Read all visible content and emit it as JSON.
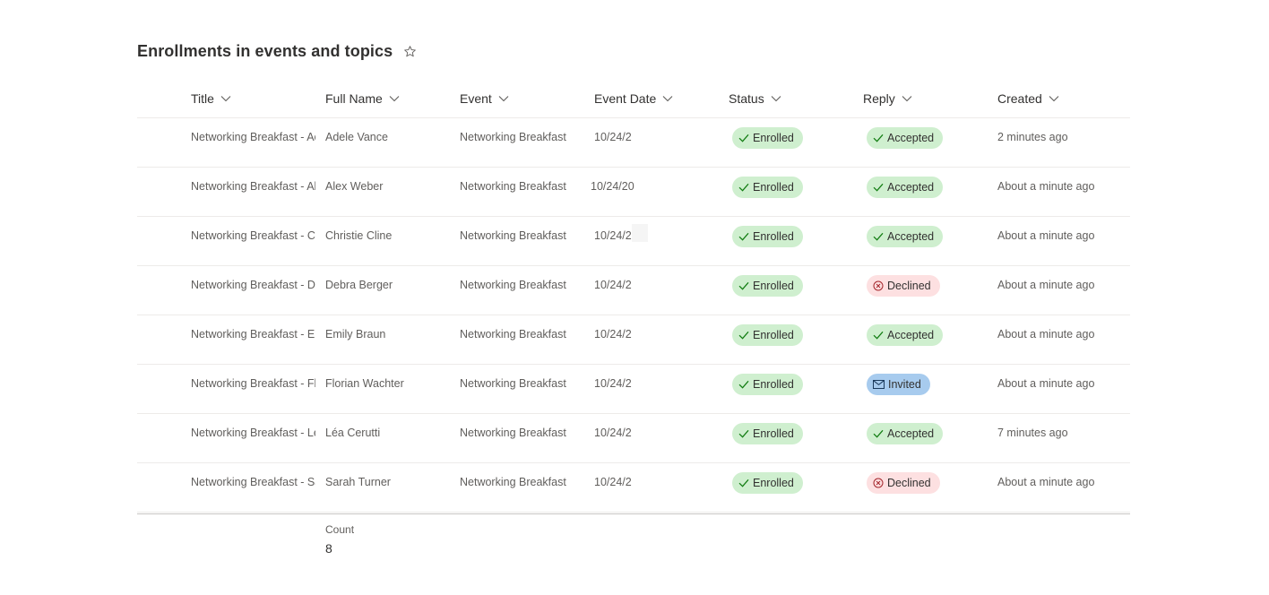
{
  "page": {
    "title": "Enrollments in events and topics",
    "favorite_icon": "star-outline-icon"
  },
  "columns": [
    "Title",
    "Full Name",
    "Event",
    "Event Date",
    "Status",
    "Reply",
    "Created"
  ],
  "rows": [
    {
      "title": "Networking Breakfast - Ac",
      "full_name": "Adele Vance",
      "event": "Networking Breakfast",
      "event_date": "10/24/2",
      "status": "Enrolled",
      "reply": "Accepted",
      "reply_type": "accepted",
      "created": "2 minutes ago"
    },
    {
      "title": "Networking Breakfast - Ale",
      "full_name": "Alex Weber",
      "event": "Networking Breakfast",
      "event_date": "10/24/20",
      "status": "Enrolled",
      "reply": "Accepted",
      "reply_type": "accepted",
      "created": "About a minute ago"
    },
    {
      "title": "Networking Breakfast - Ch",
      "full_name": "Christie Cline",
      "event": "Networking Breakfast",
      "event_date": "10/24/2",
      "status": "Enrolled",
      "reply": "Accepted",
      "reply_type": "accepted",
      "created": "About a minute ago"
    },
    {
      "title": "Networking Breakfast - De",
      "full_name": "Debra Berger",
      "event": "Networking Breakfast",
      "event_date": "10/24/2",
      "status": "Enrolled",
      "reply": "Declined",
      "reply_type": "declined",
      "created": "About a minute ago"
    },
    {
      "title": "Networking Breakfast - Em",
      "full_name": "Emily Braun",
      "event": "Networking Breakfast",
      "event_date": "10/24/2",
      "status": "Enrolled",
      "reply": "Accepted",
      "reply_type": "accepted",
      "created": "About a minute ago"
    },
    {
      "title": "Networking Breakfast - Flo",
      "full_name": "Florian Wachter",
      "event": "Networking Breakfast",
      "event_date": "10/24/2",
      "status": "Enrolled",
      "reply": "Invited",
      "reply_type": "invited",
      "created": "About a minute ago"
    },
    {
      "title": "Networking Breakfast - Léa",
      "full_name": "Léa Cerutti",
      "event": "Networking Breakfast",
      "event_date": "10/24/2",
      "status": "Enrolled",
      "reply": "Accepted",
      "reply_type": "accepted",
      "created": "7 minutes ago"
    },
    {
      "title": "Networking Breakfast - Sa",
      "full_name": "Sarah Turner",
      "event": "Networking Breakfast",
      "event_date": "10/24/2",
      "status": "Enrolled",
      "reply": "Declined",
      "reply_type": "declined",
      "created": "About a minute ago"
    }
  ],
  "footer": {
    "count_label": "Count",
    "count_value": "8"
  },
  "colors": {
    "accepted_bg": "#cfefcf",
    "declined_bg": "#fde0e1",
    "invited_bg": "#a7cbee",
    "divider": "#edebe9"
  },
  "icons": {
    "column_menu": "chevron-down-icon",
    "accepted": "checkmark-icon",
    "declined": "circle-x-icon",
    "invited": "envelope-icon"
  }
}
